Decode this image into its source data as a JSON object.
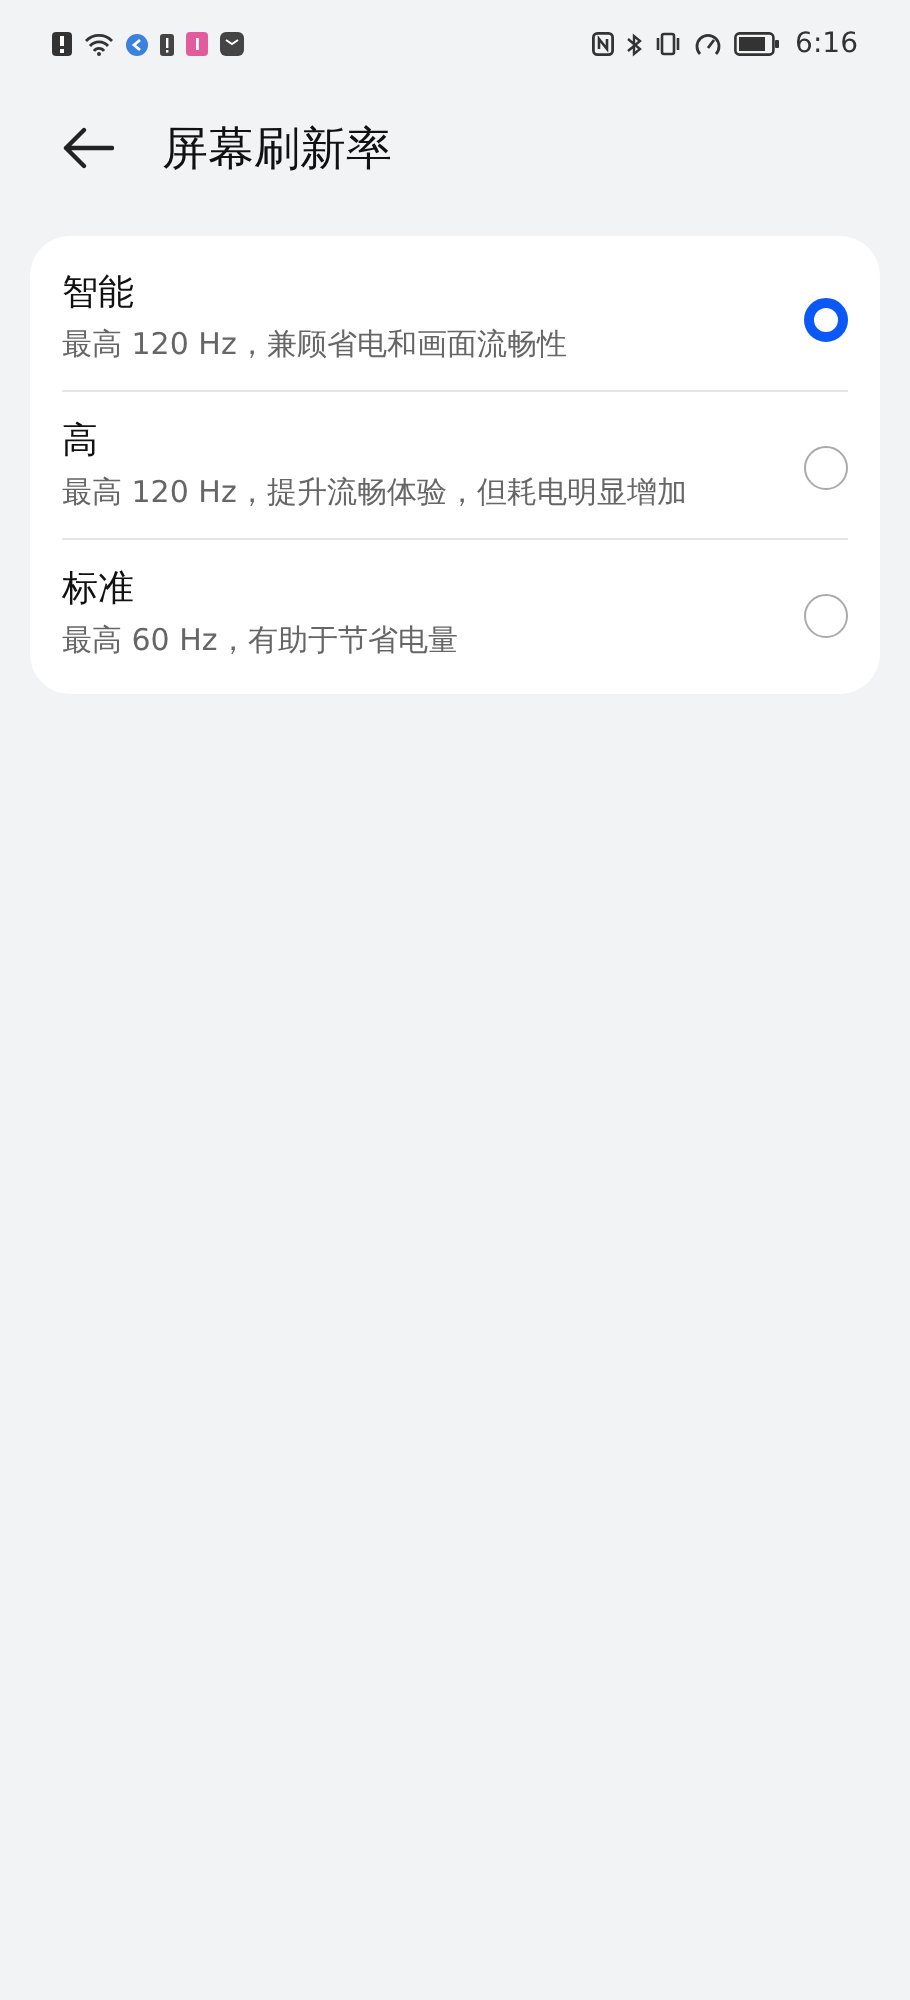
{
  "status_bar": {
    "time": "6:16"
  },
  "header": {
    "title": "屏幕刷新率"
  },
  "options": [
    {
      "label": "智能",
      "description": "最高 120 Hz，兼顾省电和画面流畅性",
      "selected": true
    },
    {
      "label": "高",
      "description": "最高 120 Hz，提升流畅体验，但耗电明显增加",
      "selected": false
    },
    {
      "label": "标准",
      "description": "最高 60 Hz，有助于节省电量",
      "selected": false
    }
  ]
}
